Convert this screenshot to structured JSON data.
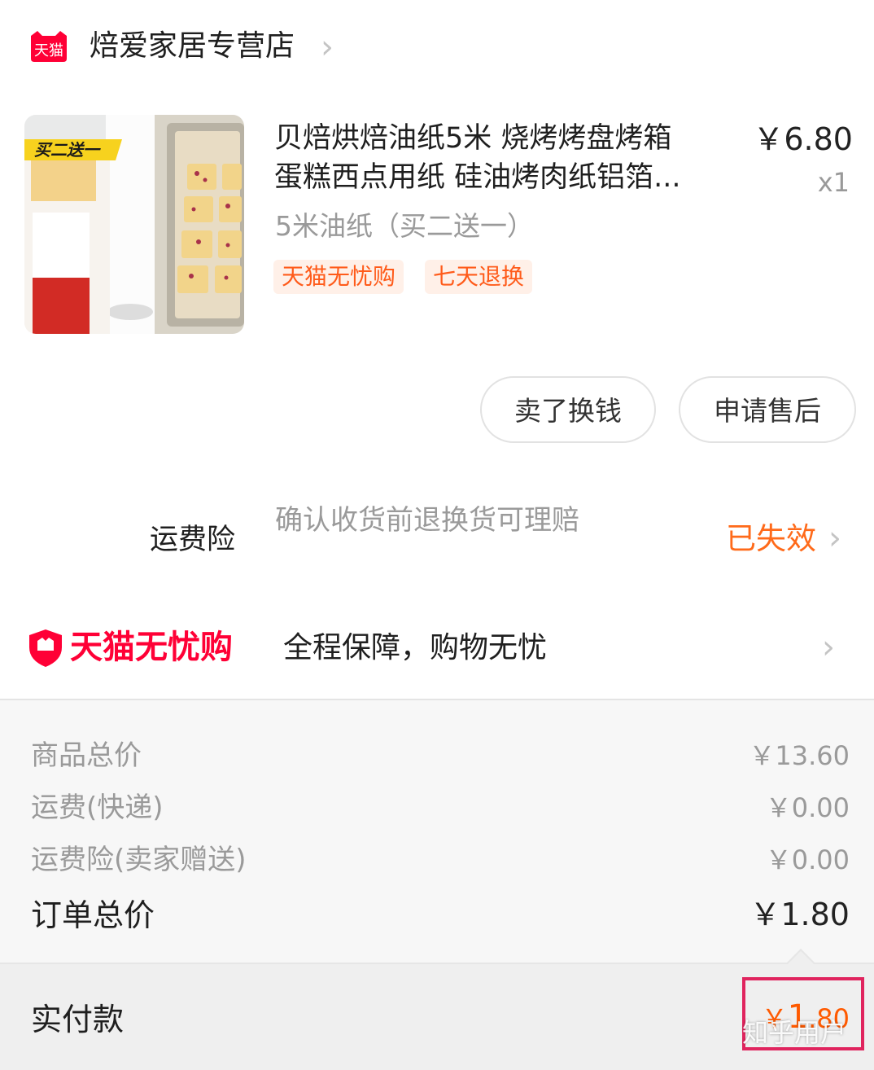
{
  "store": {
    "logo_text": "天猫",
    "name": "焙爱家居专营店"
  },
  "product": {
    "title_line1": "贝焙烘焙油纸5米 烧烤烤盘烤箱",
    "title_line2": "蛋糕西点用纸 硅油烤肉纸铝箔...",
    "price": "￥6.80",
    "quantity": "x1",
    "sku": "5米油纸（买二送一）",
    "tags": [
      "天猫无忧购",
      "七天退换"
    ],
    "image_badge": "买二送一"
  },
  "actions": {
    "sell": "卖了换钱",
    "after_sale": "申请售后"
  },
  "insurance": {
    "label": "运费险",
    "description": "确认收货前退换货可理赔",
    "status": "已失效"
  },
  "guarantee": {
    "brand": "天猫无忧购",
    "description": "全程保障，购物无忧"
  },
  "summary": {
    "rows": [
      {
        "label": "商品总价",
        "value": "￥13.60"
      },
      {
        "label": "运费(快递)",
        "value": "￥0.00"
      },
      {
        "label": "运费险(卖家赠送)",
        "value": "￥0.00"
      }
    ],
    "order_total_label": "订单总价",
    "order_total_value": "￥1.80",
    "paid_label": "实付款",
    "paid_currency": "￥",
    "paid_int": "1",
    "paid_dec": ".80"
  },
  "watermark": "知乎用户",
  "colors": {
    "tmall_red": "#ff0036",
    "tag_orange": "#ff5b1a",
    "status_orange": "#ff6a1a",
    "highlight_box": "#e0245e"
  }
}
